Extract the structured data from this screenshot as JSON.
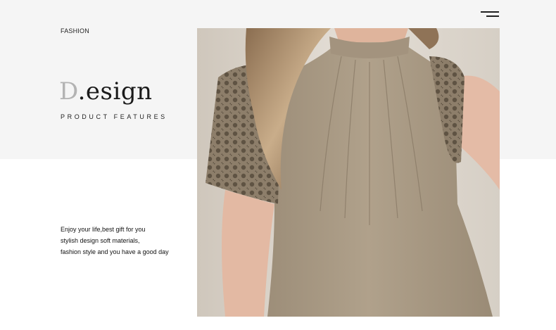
{
  "header": {
    "kicker": "FASHION",
    "menu_icon": "menu-icon"
  },
  "hero": {
    "title_initial": "D",
    "title_rest": ".esign",
    "subtitle": "PRODUCT FEATURES"
  },
  "description": {
    "lines": [
      "Enjoy your life,best gift for you",
      "stylish design soft materials,",
      "fashion style and you have a good day"
    ]
  },
  "colors": {
    "band": "#f5f5f5",
    "text": "#1a1a1a",
    "title_initial": "#b3b3b3",
    "garment": "#a99a85"
  }
}
